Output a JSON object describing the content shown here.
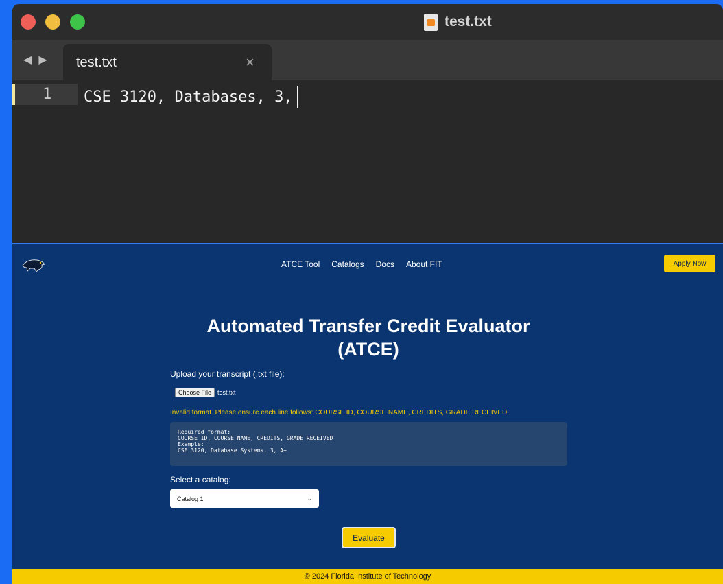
{
  "editor": {
    "window_title": "test.txt",
    "tab_label": "test.txt",
    "tab_close": "×",
    "nav_back": "◀",
    "nav_forward": "▶",
    "line_number": "1",
    "line_text": "CSE 3120, Databases, 3,",
    "icons": {
      "file": "sublime-file-icon",
      "close": "close-icon"
    },
    "colors": {
      "red": "#ee5f57",
      "yellow": "#f1bd41",
      "green": "#3fc44a"
    }
  },
  "site": {
    "nav": [
      "ATCE Tool",
      "Catalogs",
      "Docs",
      "About FIT"
    ],
    "apply_label": "Apply Now",
    "title": "Automated Transfer Credit Evaluator (ATCE)",
    "upload_label": "Upload your transcript (.txt file):",
    "choose_file_label": "Choose File",
    "chosen_file": "test.txt",
    "error": "Invalid format. Please ensure each line follows: COURSE ID, COURSE NAME, CREDITS, GRADE RECEIVED",
    "format_lines": [
      "Required format:",
      "COURSE ID, COURSE NAME, CREDITS, GRADE RECEIVED",
      "Example:",
      "CSE 3120, Database Systems, 3, A+"
    ],
    "catalog_label": "Select a catalog:",
    "catalog_selected": "Catalog 1",
    "evaluate_label": "Evaluate",
    "footer": "© 2024 Florida Institute of Technology",
    "colors": {
      "background": "#0a3570",
      "accent": "#f6cc00",
      "error": "#f6cc00"
    }
  }
}
